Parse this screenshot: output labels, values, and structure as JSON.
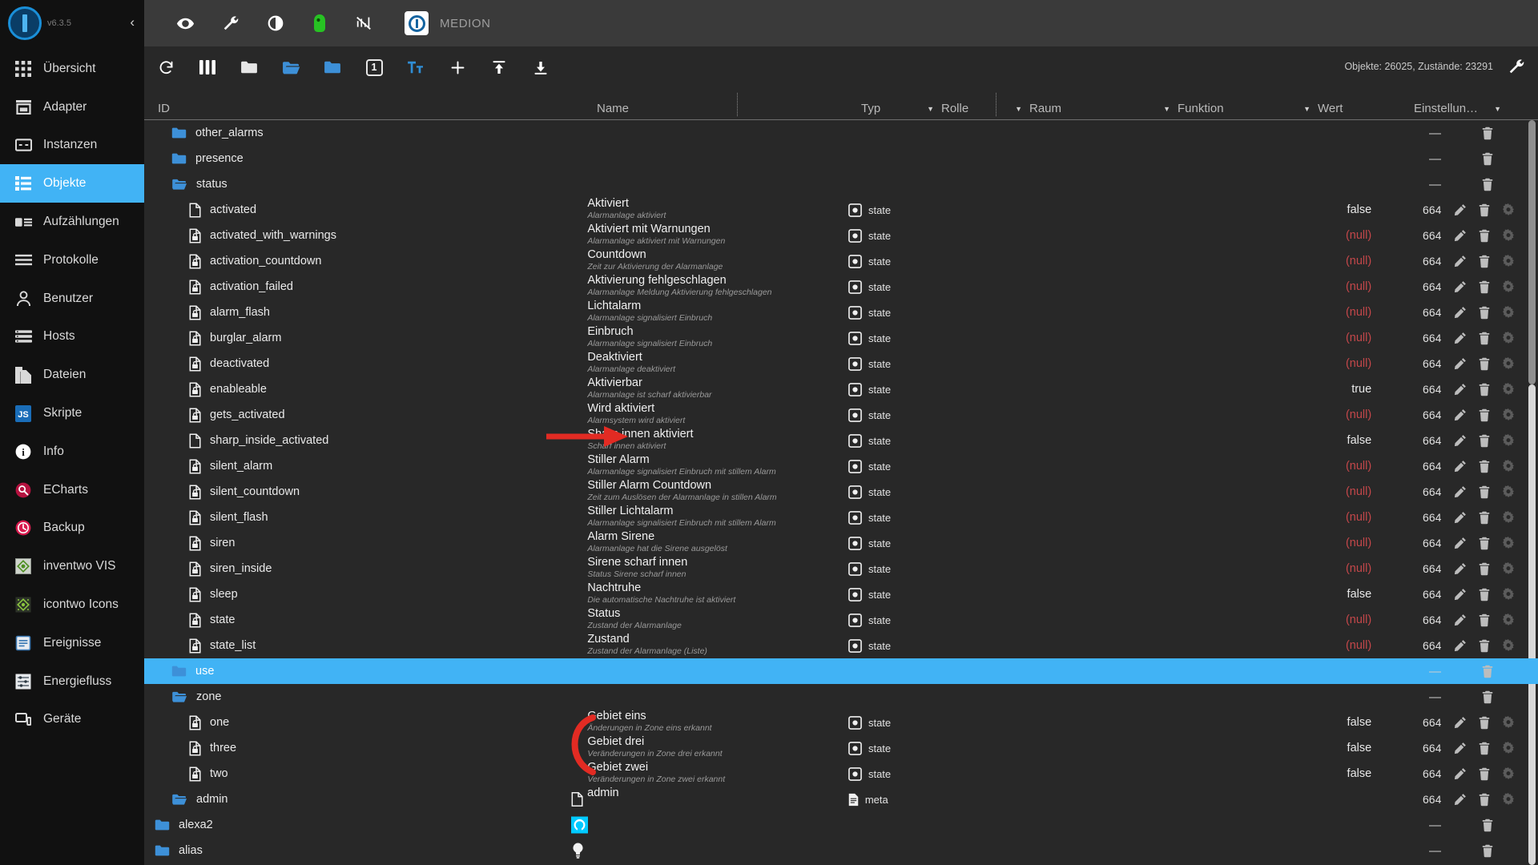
{
  "sidebar": {
    "version": "v6.3.5",
    "collapse_label": "‹",
    "items": [
      {
        "label": "Übersicht",
        "icon": "grid-icon",
        "active": false
      },
      {
        "label": "Adapter",
        "icon": "store-icon",
        "active": false
      },
      {
        "label": "Instanzen",
        "icon": "instances-icon",
        "active": false
      },
      {
        "label": "Objekte",
        "icon": "list-icon",
        "active": true
      },
      {
        "label": "Aufzählungen",
        "icon": "enum-icon",
        "active": false
      },
      {
        "label": "Protokolle",
        "icon": "log-icon",
        "active": false
      },
      {
        "label": "Benutzer",
        "icon": "user-icon",
        "active": false
      },
      {
        "label": "Hosts",
        "icon": "hosts-icon",
        "active": false
      },
      {
        "label": "Dateien",
        "icon": "files-icon",
        "active": false
      },
      {
        "label": "Skripte",
        "icon": "js-icon",
        "active": false
      },
      {
        "label": "Info",
        "icon": "info-icon",
        "active": false
      },
      {
        "label": "ECharts",
        "icon": "echarts-icon",
        "active": false
      },
      {
        "label": "Backup",
        "icon": "backup-icon",
        "active": false
      },
      {
        "label": "inventwo VIS",
        "icon": "inventwo-vis-icon",
        "active": false
      },
      {
        "label": "icontwo Icons",
        "icon": "icontwo-icons-icon",
        "active": false
      },
      {
        "label": "Ereignisse",
        "icon": "events-icon",
        "active": false
      },
      {
        "label": "Energiefluss",
        "icon": "energyflow-icon",
        "active": false
      },
      {
        "label": "Geräte",
        "icon": "devices-icon",
        "active": false
      }
    ]
  },
  "topbar": {
    "icons": [
      "eye-icon",
      "wrench-icon",
      "brightness-icon",
      "person-green-icon",
      "no-connection-icon"
    ],
    "host_name": "MEDION"
  },
  "objects_toolbar": {
    "icons": [
      "refresh-icon",
      "columns-icon",
      "folder-collapse-icon",
      "folder-open-icon",
      "folder-icon",
      "expand-level-1-icon",
      "text-size-icon",
      "add-icon",
      "import-icon",
      "export-icon"
    ],
    "level_badge": "1",
    "status_text": "Objekte: 26025, Zustände: 23291",
    "settings_icon": "wrench-icon"
  },
  "table": {
    "headers": [
      {
        "label": "ID",
        "filter": false
      },
      {
        "label": "Name",
        "filter": false
      },
      {
        "label": "Typ",
        "filter": true
      },
      {
        "label": "Rolle",
        "filter": true
      },
      {
        "label": "Raum",
        "filter": true
      },
      {
        "label": "Funktion",
        "filter": true
      },
      {
        "label": "Wert",
        "filter": false
      },
      {
        "label": "Einstellun…",
        "filter": true
      }
    ],
    "rows": [
      {
        "id": "other_alarms",
        "icon": "folder-icon",
        "indent": 1,
        "name": "",
        "desc": "",
        "type": "",
        "value": "",
        "perm": "",
        "actions": [
          "delete"
        ],
        "dash": true,
        "selected": false
      },
      {
        "id": "presence",
        "icon": "folder-icon",
        "indent": 1,
        "name": "",
        "desc": "",
        "type": "",
        "value": "",
        "perm": "",
        "actions": [
          "delete"
        ],
        "dash": true,
        "selected": false
      },
      {
        "id": "status",
        "icon": "folder-open-icon",
        "indent": 1,
        "name": "",
        "desc": "",
        "type": "",
        "value": "",
        "perm": "",
        "actions": [
          "delete"
        ],
        "dash": true,
        "selected": false
      },
      {
        "id": "activated",
        "icon": "doc-icon",
        "indent": 2,
        "name": "Aktiviert",
        "desc": "Alarmanlage aktiviert",
        "type": "state",
        "value": "false",
        "value_kind": "plain",
        "perm": "664",
        "actions": [
          "edit",
          "delete",
          "settings"
        ],
        "selected": false
      },
      {
        "id": "activated_with_warnings",
        "icon": "doc-lock-icon",
        "indent": 2,
        "name": "Aktiviert mit Warnungen",
        "desc": "Alarmanlage aktiviert mit Warnungen",
        "type": "state",
        "value": "(null)",
        "value_kind": "null",
        "perm": "664",
        "actions": [
          "edit",
          "delete",
          "settings"
        ],
        "selected": false
      },
      {
        "id": "activation_countdown",
        "icon": "doc-lock-icon",
        "indent": 2,
        "name": "Countdown",
        "desc": "Zeit zur Aktivierung der Alarmanlage",
        "type": "state",
        "value": "(null)",
        "value_kind": "null",
        "perm": "664",
        "actions": [
          "edit",
          "delete",
          "settings"
        ],
        "selected": false
      },
      {
        "id": "activation_failed",
        "icon": "doc-lock-icon",
        "indent": 2,
        "name": "Aktivierung fehlgeschlagen",
        "desc": "Alarmanlage Meldung Aktivierung fehlgeschlagen",
        "type": "state",
        "value": "(null)",
        "value_kind": "null",
        "perm": "664",
        "actions": [
          "edit",
          "delete",
          "settings"
        ],
        "selected": false
      },
      {
        "id": "alarm_flash",
        "icon": "doc-lock-icon",
        "indent": 2,
        "name": "Lichtalarm",
        "desc": "Alarmanlage signalisiert Einbruch",
        "type": "state",
        "value": "(null)",
        "value_kind": "null",
        "perm": "664",
        "actions": [
          "edit",
          "delete",
          "settings"
        ],
        "selected": false
      },
      {
        "id": "burglar_alarm",
        "icon": "doc-lock-icon",
        "indent": 2,
        "name": "Einbruch",
        "desc": "Alarmanlage signalisiert Einbruch",
        "type": "state",
        "value": "(null)",
        "value_kind": "null",
        "perm": "664",
        "actions": [
          "edit",
          "delete",
          "settings"
        ],
        "selected": false
      },
      {
        "id": "deactivated",
        "icon": "doc-lock-icon",
        "indent": 2,
        "name": "Deaktiviert",
        "desc": "Alarmanlage deaktiviert",
        "type": "state",
        "value": "(null)",
        "value_kind": "null",
        "perm": "664",
        "actions": [
          "edit",
          "delete",
          "settings"
        ],
        "selected": false
      },
      {
        "id": "enableable",
        "icon": "doc-lock-icon",
        "indent": 2,
        "name": "Aktivierbar",
        "desc": "Alarmanlage ist scharf aktivierbar",
        "type": "state",
        "value": "true",
        "value_kind": "plain",
        "perm": "664",
        "actions": [
          "edit",
          "delete",
          "settings"
        ],
        "selected": false
      },
      {
        "id": "gets_activated",
        "icon": "doc-lock-icon",
        "indent": 2,
        "name": "Wird aktiviert",
        "desc": "Alarmsystem wird aktiviert",
        "type": "state",
        "value": "(null)",
        "value_kind": "null",
        "perm": "664",
        "actions": [
          "edit",
          "delete",
          "settings"
        ],
        "selected": false
      },
      {
        "id": "sharp_inside_activated",
        "icon": "doc-icon",
        "indent": 2,
        "name": "Sharp innen aktiviert",
        "desc": "Scharf innen aktiviert",
        "type": "state",
        "value": "false",
        "value_kind": "plain",
        "perm": "664",
        "actions": [
          "edit",
          "delete",
          "settings"
        ],
        "selected": false
      },
      {
        "id": "silent_alarm",
        "icon": "doc-lock-icon",
        "indent": 2,
        "name": "Stiller Alarm",
        "desc": "Alarmanlage signalisiert Einbruch mit stillem Alarm",
        "type": "state",
        "value": "(null)",
        "value_kind": "null",
        "perm": "664",
        "actions": [
          "edit",
          "delete",
          "settings"
        ],
        "selected": false
      },
      {
        "id": "silent_countdown",
        "icon": "doc-lock-icon",
        "indent": 2,
        "name": "Stiller Alarm Countdown",
        "desc": "Zeit zum Auslösen der Alarmanlage in stillen Alarm",
        "type": "state",
        "value": "(null)",
        "value_kind": "null",
        "perm": "664",
        "actions": [
          "edit",
          "delete",
          "settings"
        ],
        "selected": false
      },
      {
        "id": "silent_flash",
        "icon": "doc-lock-icon",
        "indent": 2,
        "name": "Stiller Lichtalarm",
        "desc": "Alarmanlage signalisiert Einbruch mit stillem Alarm",
        "type": "state",
        "value": "(null)",
        "value_kind": "null",
        "perm": "664",
        "actions": [
          "edit",
          "delete",
          "settings"
        ],
        "selected": false
      },
      {
        "id": "siren",
        "icon": "doc-lock-icon",
        "indent": 2,
        "name": "Alarm Sirene",
        "desc": "Alarmanlage hat die Sirene ausgelöst",
        "type": "state",
        "value": "(null)",
        "value_kind": "null",
        "perm": "664",
        "actions": [
          "edit",
          "delete",
          "settings"
        ],
        "selected": false
      },
      {
        "id": "siren_inside",
        "icon": "doc-lock-icon",
        "indent": 2,
        "name": "Sirene scharf innen",
        "desc": "Status Sirene scharf innen",
        "type": "state",
        "value": "(null)",
        "value_kind": "null",
        "perm": "664",
        "actions": [
          "edit",
          "delete",
          "settings"
        ],
        "selected": false
      },
      {
        "id": "sleep",
        "icon": "doc-lock-icon",
        "indent": 2,
        "name": "Nachtruhe",
        "desc": "Die automatische Nachtruhe ist aktiviert",
        "type": "state",
        "value": "false",
        "value_kind": "plain",
        "perm": "664",
        "actions": [
          "edit",
          "delete",
          "settings"
        ],
        "selected": false
      },
      {
        "id": "state",
        "icon": "doc-lock-icon",
        "indent": 2,
        "name": "Status",
        "desc": "Zustand der Alarmanlage",
        "type": "state",
        "value": "(null)",
        "value_kind": "null",
        "perm": "664",
        "actions": [
          "edit",
          "delete",
          "settings"
        ],
        "selected": false
      },
      {
        "id": "state_list",
        "icon": "doc-lock-icon",
        "indent": 2,
        "name": "Zustand",
        "desc": "Zustand der Alarmanlage (Liste)",
        "type": "state",
        "value": "(null)",
        "value_kind": "null",
        "perm": "664",
        "actions": [
          "edit",
          "delete",
          "settings"
        ],
        "selected": false
      },
      {
        "id": "use",
        "icon": "folder-icon",
        "indent": 1,
        "name": "",
        "desc": "",
        "type": "",
        "value": "",
        "perm": "",
        "actions": [
          "delete"
        ],
        "dash": true,
        "selected": true
      },
      {
        "id": "zone",
        "icon": "folder-open-icon",
        "indent": 1,
        "name": "",
        "desc": "",
        "type": "",
        "value": "",
        "perm": "",
        "actions": [
          "delete"
        ],
        "dash": true,
        "selected": false
      },
      {
        "id": "one",
        "icon": "doc-lock-icon",
        "indent": 2,
        "name": "Gebiet eins",
        "desc": "Änderungen in Zone eins erkannt",
        "type": "state",
        "value": "false",
        "value_kind": "plain",
        "perm": "664",
        "actions": [
          "edit",
          "delete",
          "settings"
        ],
        "selected": false
      },
      {
        "id": "three",
        "icon": "doc-lock-icon",
        "indent": 2,
        "name": "Gebiet drei",
        "desc": "Veränderungen in Zone drei erkannt",
        "type": "state",
        "value": "false",
        "value_kind": "plain",
        "perm": "664",
        "actions": [
          "edit",
          "delete",
          "settings"
        ],
        "selected": false
      },
      {
        "id": "two",
        "icon": "doc-lock-icon",
        "indent": 2,
        "name": "Gebiet zwei",
        "desc": "Veränderungen in Zone zwei erkannt",
        "type": "state",
        "value": "false",
        "value_kind": "plain",
        "perm": "664",
        "actions": [
          "edit",
          "delete",
          "settings"
        ],
        "selected": false
      },
      {
        "id": "admin",
        "icon": "folder-open-icon",
        "indent": 1,
        "name": "admin",
        "name_icon": "doc-icon",
        "desc": "",
        "type": "meta",
        "type_icon": "doc-icon",
        "value": "",
        "perm": "664",
        "actions": [
          "edit",
          "delete",
          "settings"
        ],
        "selected": false
      },
      {
        "id": "alexa2",
        "icon": "folder-icon",
        "indent": 0,
        "name": "",
        "name_icon": "alexa-icon",
        "desc": "",
        "type": "",
        "value": "",
        "perm": "",
        "actions": [
          "delete"
        ],
        "dash": true,
        "selected": false
      },
      {
        "id": "alias",
        "icon": "folder-icon",
        "indent": 0,
        "name": "",
        "name_icon": "bulb-icon",
        "desc": "",
        "type": "",
        "value": "",
        "perm": "",
        "actions": [
          "delete"
        ],
        "dash": true,
        "selected": false
      }
    ]
  },
  "annotations": {
    "arrow_target_row": "sharp_inside_activated",
    "arc_target_rows": [
      "one",
      "three"
    ],
    "color": "#e22b23"
  },
  "colors": {
    "accent": "#41b3f5",
    "null_value": "#c4474a",
    "sidebar_bg": "#111111",
    "content_bg": "#282828",
    "topbar_bg": "#3a3a3a"
  }
}
